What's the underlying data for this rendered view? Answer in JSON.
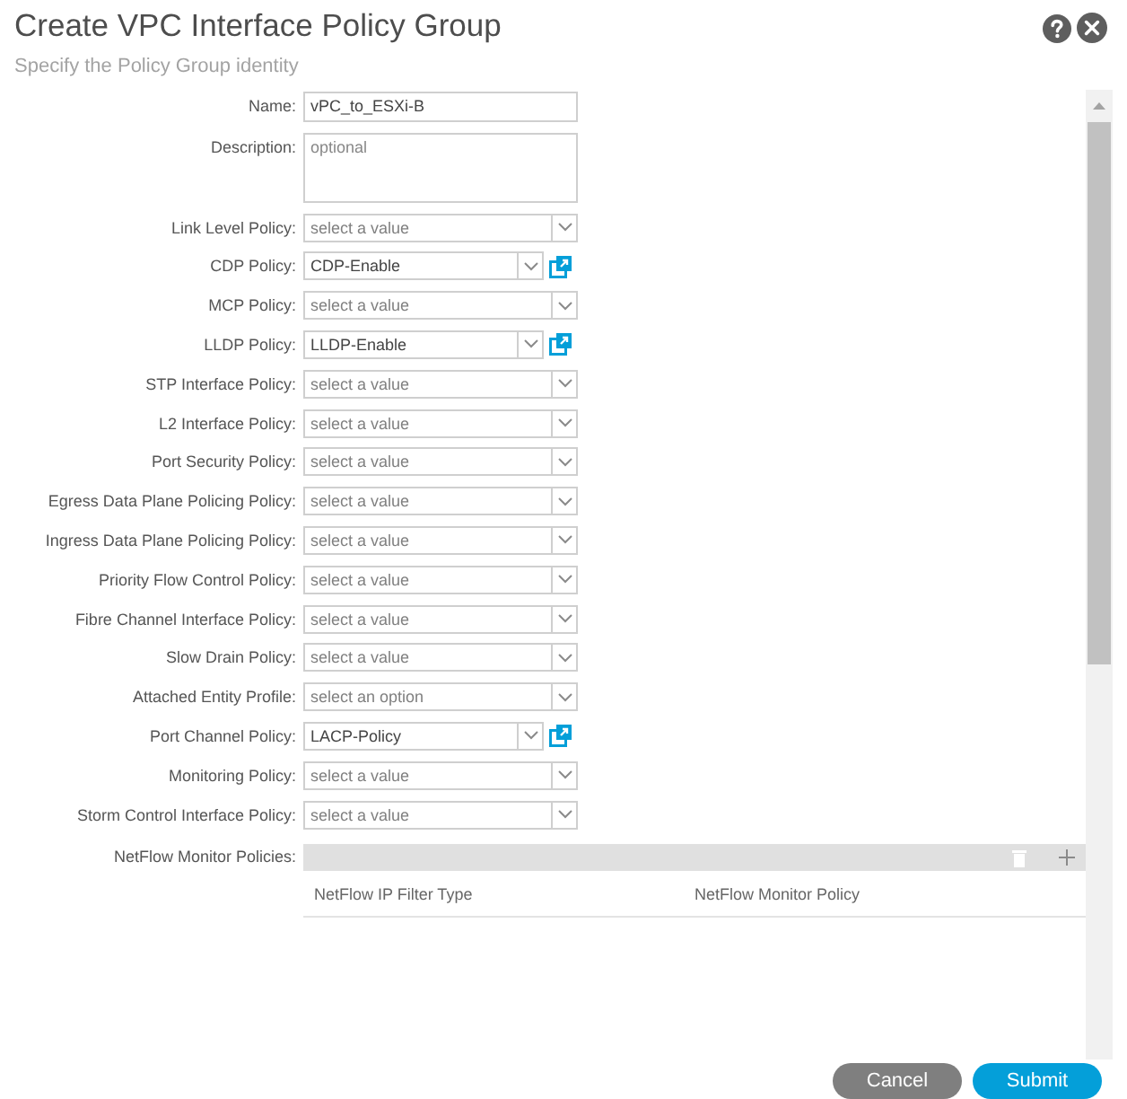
{
  "dialog": {
    "title": "Create VPC Interface Policy Group",
    "subtitle": "Specify the Policy Group identity"
  },
  "fields": [
    {
      "kind": "text",
      "label": "Name:",
      "value": "vPC_to_ESXi-B"
    },
    {
      "kind": "textarea",
      "label": "Description:",
      "placeholder": "optional"
    },
    {
      "kind": "select",
      "label": "Link Level Policy:",
      "placeholder": "select a value",
      "linked": false
    },
    {
      "kind": "select",
      "label": "CDP Policy:",
      "value": "CDP-Enable",
      "linked": true
    },
    {
      "kind": "select",
      "label": "MCP Policy:",
      "placeholder": "select a value",
      "linked": false
    },
    {
      "kind": "select",
      "label": "LLDP Policy:",
      "value": "LLDP-Enable",
      "linked": true
    },
    {
      "kind": "select",
      "label": "STP Interface Policy:",
      "placeholder": "select a value",
      "linked": false
    },
    {
      "kind": "select",
      "label": "L2 Interface Policy:",
      "placeholder": "select a value",
      "linked": false
    },
    {
      "kind": "select",
      "label": "Port Security Policy:",
      "placeholder": "select a value",
      "linked": false
    },
    {
      "kind": "select",
      "label": "Egress Data Plane Policing Policy:",
      "placeholder": "select a value",
      "linked": false
    },
    {
      "kind": "select",
      "label": "Ingress Data Plane Policing Policy:",
      "placeholder": "select a value",
      "linked": false
    },
    {
      "kind": "select",
      "label": "Priority Flow Control Policy:",
      "placeholder": "select a value",
      "linked": false
    },
    {
      "kind": "select",
      "label": "Fibre Channel Interface Policy:",
      "placeholder": "select a value",
      "linked": false
    },
    {
      "kind": "select",
      "label": "Slow Drain Policy:",
      "placeholder": "select a value",
      "linked": false
    },
    {
      "kind": "select",
      "label": "Attached Entity Profile:",
      "placeholder": "select an option",
      "linked": false
    },
    {
      "kind": "select",
      "label": "Port Channel Policy:",
      "value": "LACP-Policy",
      "linked": true
    },
    {
      "kind": "select",
      "label": "Monitoring Policy:",
      "placeholder": "select a value",
      "linked": false
    },
    {
      "kind": "select",
      "label": "Storm Control Interface Policy:",
      "placeholder": "select a value",
      "linked": false
    }
  ],
  "netflow_monitor_policies": {
    "label": "NetFlow Monitor Policies:",
    "columns": [
      "NetFlow IP Filter Type",
      "NetFlow Monitor Policy"
    ]
  },
  "buttons": [
    {
      "label": "Cancel",
      "kind": "secondary"
    },
    {
      "label": "Submit",
      "kind": "primary"
    }
  ]
}
